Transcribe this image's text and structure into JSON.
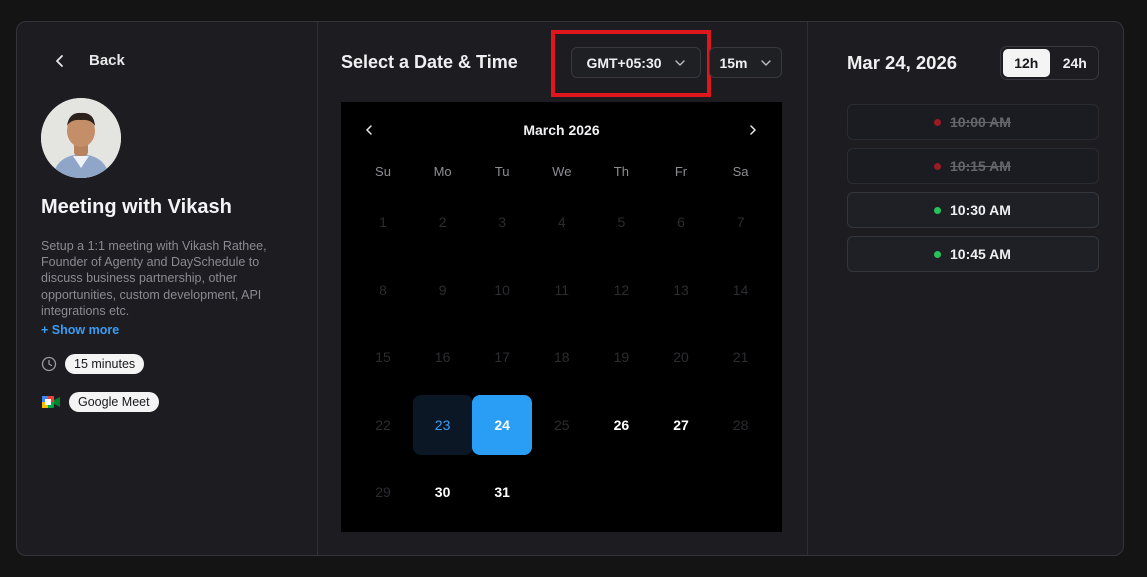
{
  "left": {
    "back_label": "Back",
    "title": "Meeting with Vikash",
    "description": "Setup a 1:1 meeting with Vikash Rathee, Founder of Agenty and DaySchedule to discuss business partnership, other opportunities, custom development, API integrations etc.",
    "show_more": "+ Show more",
    "duration": "15 minutes",
    "location": "Google Meet"
  },
  "middle": {
    "title": "Select a Date & Time",
    "timezone": "GMT+05:30",
    "slot_length": "15m",
    "highlight_color": "#e0161d"
  },
  "calendar": {
    "month_label": "March 2026",
    "weekdays": [
      "Su",
      "Mo",
      "Tu",
      "We",
      "Th",
      "Fr",
      "Sa"
    ],
    "weeks": [
      [
        "1",
        "2",
        "3",
        "4",
        "5",
        "6",
        "7"
      ],
      [
        "8",
        "9",
        "10",
        "11",
        "12",
        "13",
        "14"
      ],
      [
        "15",
        "16",
        "17",
        "18",
        "19",
        "20",
        "21"
      ],
      [
        "22",
        "23",
        "24",
        "25",
        "26",
        "27",
        "28"
      ],
      [
        "29",
        "30",
        "31"
      ]
    ],
    "available": [
      "24",
      "26",
      "27",
      "30",
      "31"
    ],
    "today": "23",
    "selected": "24"
  },
  "right": {
    "date": "Mar 24, 2026",
    "format_12h": "12h",
    "format_24h": "24h",
    "active_format": "12h",
    "slots": [
      {
        "time": "10:00 AM",
        "status": "booked"
      },
      {
        "time": "10:15 AM",
        "status": "booked"
      },
      {
        "time": "10:30 AM",
        "status": "open"
      },
      {
        "time": "10:45 AM",
        "status": "open"
      }
    ]
  },
  "colors": {
    "accent": "#2a9df4",
    "link": "#3b9cf5",
    "available_dot": "#25c35a",
    "booked_dot": "#9b1b24"
  }
}
